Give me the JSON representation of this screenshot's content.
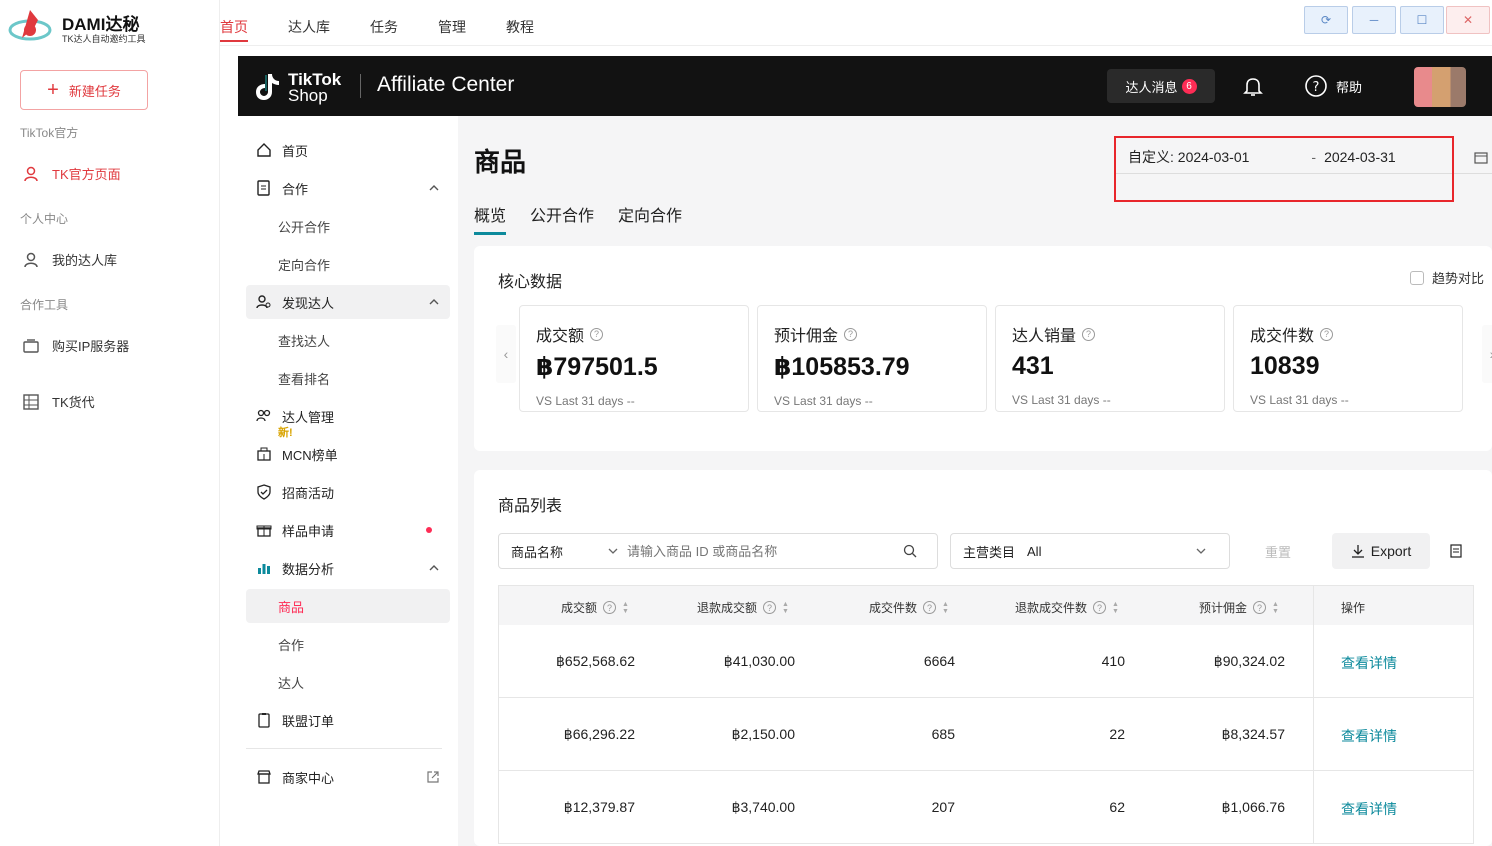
{
  "app": {
    "brand": "DAMI达秘",
    "tagline": "TK达人自动邀约工具",
    "new_task": "新建任务",
    "sections": [
      {
        "title": "TikTok官方",
        "items": [
          {
            "label": "TK官方页面",
            "icon": "user-icon",
            "active": true
          }
        ]
      },
      {
        "title": "个人中心",
        "items": [
          {
            "label": "我的达人库",
            "icon": "user-icon",
            "active": false
          }
        ]
      },
      {
        "title": "合作工具",
        "items": [
          {
            "label": "购买IP服务器",
            "icon": "server-icon",
            "active": false
          },
          {
            "label": "TK货代",
            "icon": "grid-icon",
            "active": false
          }
        ]
      }
    ]
  },
  "topnav": {
    "tabs": [
      "首页",
      "达人库",
      "任务",
      "管理",
      "教程"
    ],
    "active_tab": "首页",
    "window_controls": [
      "refresh-icon",
      "minimize-icon",
      "maximize-icon",
      "close-icon"
    ]
  },
  "tiktok": {
    "logo_line1": "TikTok",
    "logo_line2": "Shop",
    "title": "Affiliate Center",
    "messages_label": "达人消息",
    "messages_count": "6",
    "help_label": "帮助"
  },
  "tt_sidebar": {
    "home": "首页",
    "cooperation": "合作",
    "public_coop": "公开合作",
    "targeted_coop": "定向合作",
    "discover": "发现达人",
    "find_creators": "查找达人",
    "ranking": "查看排名",
    "creator_mgmt": "达人管理",
    "new_badge": "新!",
    "mcn": "MCN榜单",
    "campaigns": "招商活动",
    "samples": "样品申请",
    "analytics": "数据分析",
    "products": "商品",
    "coop_sub": "合作",
    "creators_sub": "达人",
    "orders": "联盟订单",
    "merchant": "商家中心"
  },
  "main": {
    "title": "商品",
    "date_start": "自定义: 2024-03-01",
    "date_sep": "-",
    "date_end": "2024-03-31",
    "subtabs": [
      "概览",
      "公开合作",
      "定向合作"
    ],
    "core_title": "核心数据",
    "trend_label": "趋势对比",
    "metrics": [
      {
        "label": "成交额",
        "value": "฿797501.5",
        "compare": "VS Last 31 days --"
      },
      {
        "label": "预计佣金",
        "value": "฿105853.79",
        "compare": "VS Last 31 days --"
      },
      {
        "label": "达人销量",
        "value": "431",
        "compare": "VS Last 31 days --"
      },
      {
        "label": "成交件数",
        "value": "10839",
        "compare": "VS Last 31 days --"
      }
    ],
    "list_title": "商品列表",
    "filter_field": "商品名称",
    "search_placeholder": "请输入商品 ID 或商品名称",
    "category_label": "主营类目",
    "category_value": "All",
    "reset": "重置",
    "export": "Export",
    "columns": [
      "成交额",
      "退款成交额",
      "成交件数",
      "退款成交件数",
      "预计佣金",
      "操作"
    ],
    "rows": [
      [
        "฿652,568.62",
        "฿41,030.00",
        "6664",
        "410",
        "฿90,324.02",
        "查看详情"
      ],
      [
        "฿66,296.22",
        "฿2,150.00",
        "685",
        "22",
        "฿8,324.57",
        "查看详情"
      ],
      [
        "฿12,379.87",
        "฿3,740.00",
        "207",
        "62",
        "฿1,066.76",
        "查看详情"
      ]
    ]
  },
  "colors": {
    "accent_red": "#e0393e",
    "tiktok_pink": "#fe2c55",
    "teal": "#0d8a9c",
    "highlight": "#e8262b"
  }
}
